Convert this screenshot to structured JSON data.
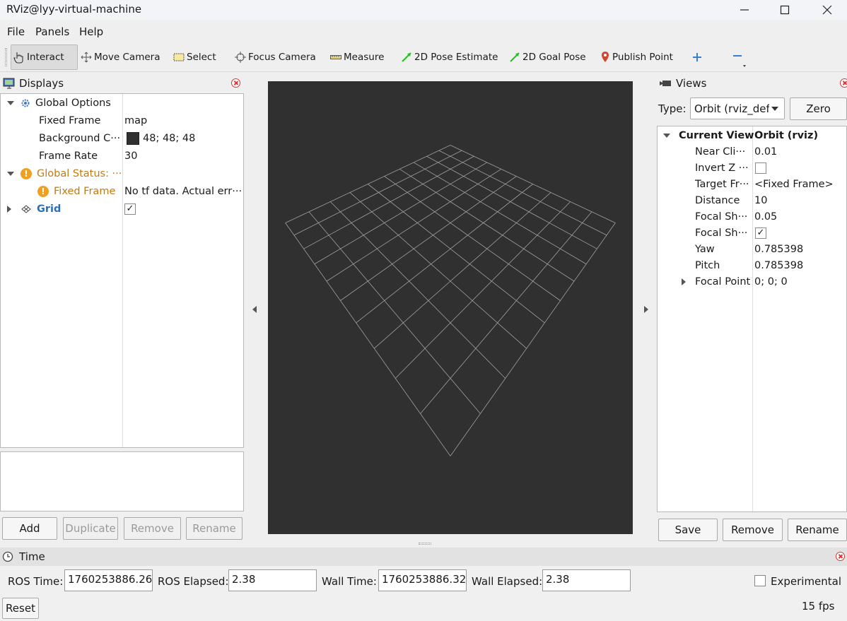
{
  "window": {
    "title": "RViz@lyy-virtual-machine"
  },
  "menu": {
    "file": "File",
    "panels": "Panels",
    "help": "Help"
  },
  "toolbar": {
    "interact": "Interact",
    "move_camera": "Move Camera",
    "select": "Select",
    "focus_camera": "Focus Camera",
    "measure": "Measure",
    "pose_estimate": "2D Pose Estimate",
    "goal_pose": "2D Goal Pose",
    "publish_point": "Publish Point"
  },
  "displays": {
    "title": "Displays",
    "global_options": "Global Options",
    "fixed_frame_label": "Fixed Frame",
    "fixed_frame_value": "map",
    "background_label": "Background C···",
    "background_value": "48; 48; 48",
    "background_color": "#303030",
    "frame_rate_label": "Frame Rate",
    "frame_rate_value": "30",
    "global_status": "Global Status: ···",
    "status_fixed_frame": "Fixed Frame",
    "status_fixed_frame_value": "No tf data.  Actual err···",
    "grid": "Grid",
    "buttons": {
      "add": "Add",
      "duplicate": "Duplicate",
      "remove": "Remove",
      "rename": "Rename"
    }
  },
  "views": {
    "title": "Views",
    "type_label": "Type:",
    "type_value": "Orbit (rviz_defa",
    "zero": "Zero",
    "current_view": "Current View",
    "current_view_value": "Orbit (rviz)",
    "props": [
      {
        "label": "Near Cli···",
        "value": "0.01"
      },
      {
        "label": "Invert Z ···",
        "value": ""
      },
      {
        "label": "Target Fr···",
        "value": "<Fixed Frame>"
      },
      {
        "label": "Distance",
        "value": "10"
      },
      {
        "label": "Focal Sh···",
        "value": "0.05"
      },
      {
        "label": "Focal Sh···",
        "value": ""
      },
      {
        "label": "Yaw",
        "value": "0.785398"
      },
      {
        "label": "Pitch",
        "value": "0.785398"
      },
      {
        "label": "Focal Point",
        "value": "0; 0; 0"
      }
    ],
    "buttons": {
      "save": "Save",
      "remove": "Remove",
      "rename": "Rename"
    }
  },
  "time": {
    "title": "Time",
    "ros_time_label": "ROS Time:",
    "ros_time": "1760253886.26",
    "ros_elapsed_label": "ROS Elapsed:",
    "ros_elapsed": "2.38",
    "wall_time_label": "Wall Time:",
    "wall_time": "1760253886.32",
    "wall_elapsed_label": "Wall Elapsed:",
    "wall_elapsed": "2.38",
    "experimental": "Experimental",
    "reset": "Reset",
    "fps": "15 fps"
  }
}
